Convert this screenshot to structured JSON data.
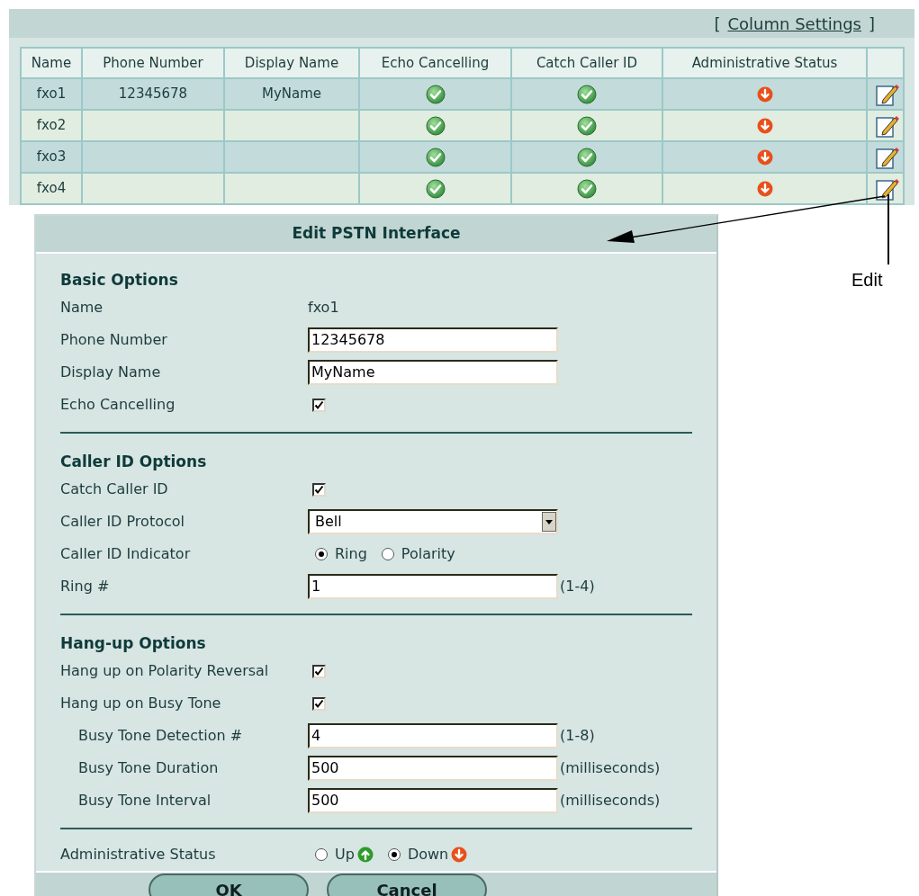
{
  "column_settings": {
    "open": "[",
    "label": "Column Settings",
    "close": "]"
  },
  "table": {
    "columns": [
      "Name",
      "Phone Number",
      "Display Name",
      "Echo Cancelling",
      "Catch Caller ID",
      "Administrative Status"
    ],
    "rows": [
      {
        "name": "fxo1",
        "phone": "12345678",
        "display_name": "MyName",
        "echo_cancelling": true,
        "catch_caller_id": true,
        "admin_up": false
      },
      {
        "name": "fxo2",
        "phone": "",
        "display_name": "",
        "echo_cancelling": true,
        "catch_caller_id": true,
        "admin_up": false
      },
      {
        "name": "fxo3",
        "phone": "",
        "display_name": "",
        "echo_cancelling": true,
        "catch_caller_id": true,
        "admin_up": false
      },
      {
        "name": "fxo4",
        "phone": "",
        "display_name": "",
        "echo_cancelling": true,
        "catch_caller_id": true,
        "admin_up": false
      }
    ]
  },
  "dialog": {
    "title": "Edit PSTN Interface",
    "sections": [
      {
        "heading": "Basic Options",
        "fields": [
          {
            "kind": "text",
            "label": "Name",
            "value": "fxo1"
          },
          {
            "kind": "input",
            "label": "Phone Number",
            "value": "12345678"
          },
          {
            "kind": "input",
            "label": "Display Name",
            "value": "MyName"
          },
          {
            "kind": "checkbox",
            "label": "Echo Cancelling",
            "checked": true
          }
        ]
      },
      {
        "heading": "Caller ID Options",
        "fields": [
          {
            "kind": "checkbox",
            "label": "Catch Caller ID",
            "checked": true
          },
          {
            "kind": "select",
            "label": "Caller ID Protocol",
            "value": "Bell"
          },
          {
            "kind": "radio",
            "label": "Caller ID Indicator",
            "options": [
              {
                "label": "Ring",
                "selected": true
              },
              {
                "label": "Polarity",
                "selected": false
              }
            ]
          },
          {
            "kind": "input",
            "label": "Ring #",
            "value": "1",
            "hint": "(1-4)"
          }
        ]
      },
      {
        "heading": "Hang-up Options",
        "fields": [
          {
            "kind": "checkbox",
            "label": "Hang up on Polarity Reversal",
            "checked": true
          },
          {
            "kind": "checkbox",
            "label": "Hang up on Busy Tone",
            "checked": true,
            "children": [
              {
                "kind": "input",
                "label": "Busy Tone Detection #",
                "value": "4",
                "hint": "(1-8)"
              },
              {
                "kind": "input",
                "label": "Busy Tone Duration",
                "value": "500",
                "hint": "(milliseconds)"
              },
              {
                "kind": "input",
                "label": "Busy Tone Interval",
                "value": "500",
                "hint": "(milliseconds)"
              }
            ]
          }
        ]
      },
      {
        "fields": [
          {
            "kind": "radio",
            "label": "Administrative Status",
            "options": [
              {
                "label": "Up",
                "selected": false,
                "up": true
              },
              {
                "label": "Down",
                "selected": true,
                "up": false
              }
            ]
          }
        ]
      }
    ],
    "buttons": [
      "OK",
      "Cancel"
    ]
  },
  "callout": {
    "label": "Edit"
  }
}
